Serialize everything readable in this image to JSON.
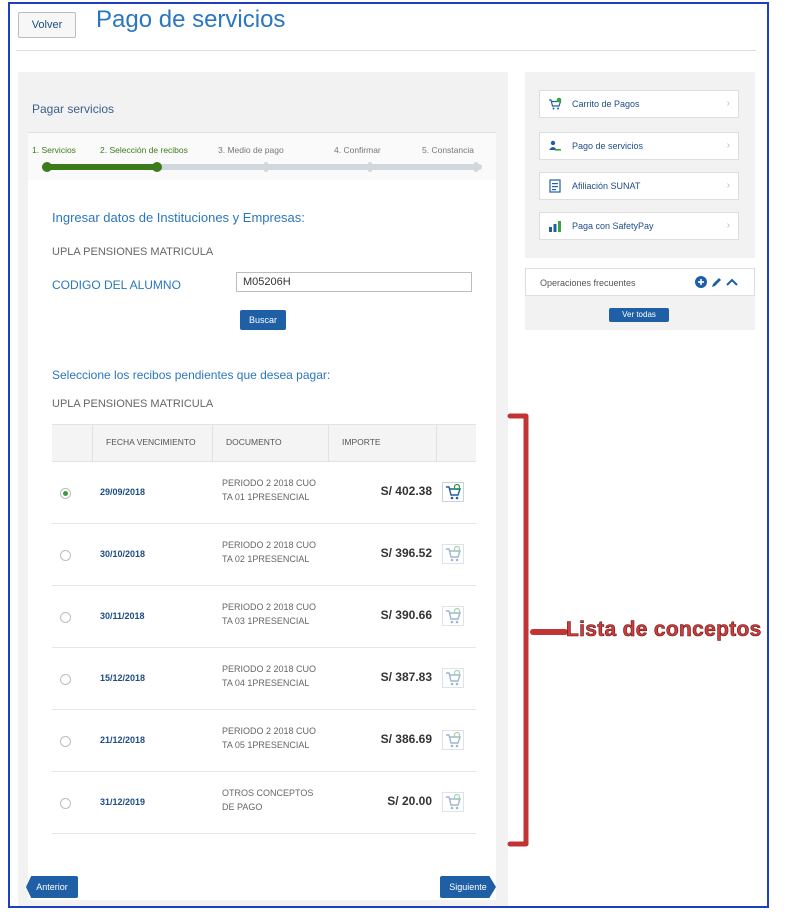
{
  "header": {
    "back_label": "Volver",
    "title": "Pago de servicios"
  },
  "panel": {
    "title": "Pagar servicios",
    "steps": [
      {
        "label": "1. Servicios",
        "state": "done"
      },
      {
        "label": "2. Selección de recibos",
        "state": "active"
      },
      {
        "label": "3. Medio de pago",
        "state": "pending"
      },
      {
        "label": "4. Confirmar",
        "state": "pending"
      },
      {
        "label": "5. Constancia",
        "state": "pending"
      }
    ]
  },
  "form": {
    "section_title": "Ingresar datos de Instituciones y Empresas:",
    "institution": "UPLA PENSIONES MATRICULA",
    "code_label": "CODIGO DEL ALUMNO",
    "code_value": "M05206H",
    "search_label": "Buscar"
  },
  "receipts": {
    "section_title": "Seleccione los recibos pendientes que desea pagar:",
    "institution": "UPLA PENSIONES MATRICULA",
    "columns": [
      "FECHA VENCIMIENTO",
      "DOCUMENTO",
      "IMPORTE"
    ],
    "rows": [
      {
        "selected": true,
        "date": "29/09/2018",
        "doc_line1": "PERIODO 2 2018 CUO",
        "doc_line2": "TA 01 1PRESENCIAL",
        "amount": "S/ 402.38"
      },
      {
        "selected": false,
        "date": "30/10/2018",
        "doc_line1": "PERIODO 2 2018 CUO",
        "doc_line2": "TA 02 1PRESENCIAL",
        "amount": "S/ 396.52"
      },
      {
        "selected": false,
        "date": "30/11/2018",
        "doc_line1": "PERIODO 2 2018 CUO",
        "doc_line2": "TA 03 1PRESENCIAL",
        "amount": "S/ 390.66"
      },
      {
        "selected": false,
        "date": "15/12/2018",
        "doc_line1": "PERIODO 2 2018 CUO",
        "doc_line2": "TA 04 1PRESENCIAL",
        "amount": "S/ 387.83"
      },
      {
        "selected": false,
        "date": "21/12/2018",
        "doc_line1": "PERIODO 2 2018 CUO",
        "doc_line2": "TA 05 1PRESENCIAL",
        "amount": "S/ 386.69"
      },
      {
        "selected": false,
        "date": "31/12/2019",
        "doc_line1": "OTROS CONCEPTOS",
        "doc_line2": "DE PAGO",
        "amount": "S/ 20.00"
      }
    ]
  },
  "nav": {
    "prev_label": "Anterior",
    "next_label": "Siguiente"
  },
  "sidebar": {
    "items": [
      {
        "label": "Carrito de Pagos",
        "icon": "cart-icon"
      },
      {
        "label": "Pago de servicios",
        "icon": "people-icon"
      },
      {
        "label": "Afiliación SUNAT",
        "icon": "document-icon"
      },
      {
        "label": "Paga con SafetyPay",
        "icon": "chart-icon"
      }
    ],
    "frequent": {
      "label": "Operaciones frecuentes",
      "view_all_label": "Ver todas"
    }
  },
  "annotation": {
    "text": "Lista de conceptos",
    "color": "#d33c3c"
  },
  "colors": {
    "accent": "#1f5fa6",
    "title_blue": "#2a77c0",
    "progress_green": "#3c7a1c"
  }
}
